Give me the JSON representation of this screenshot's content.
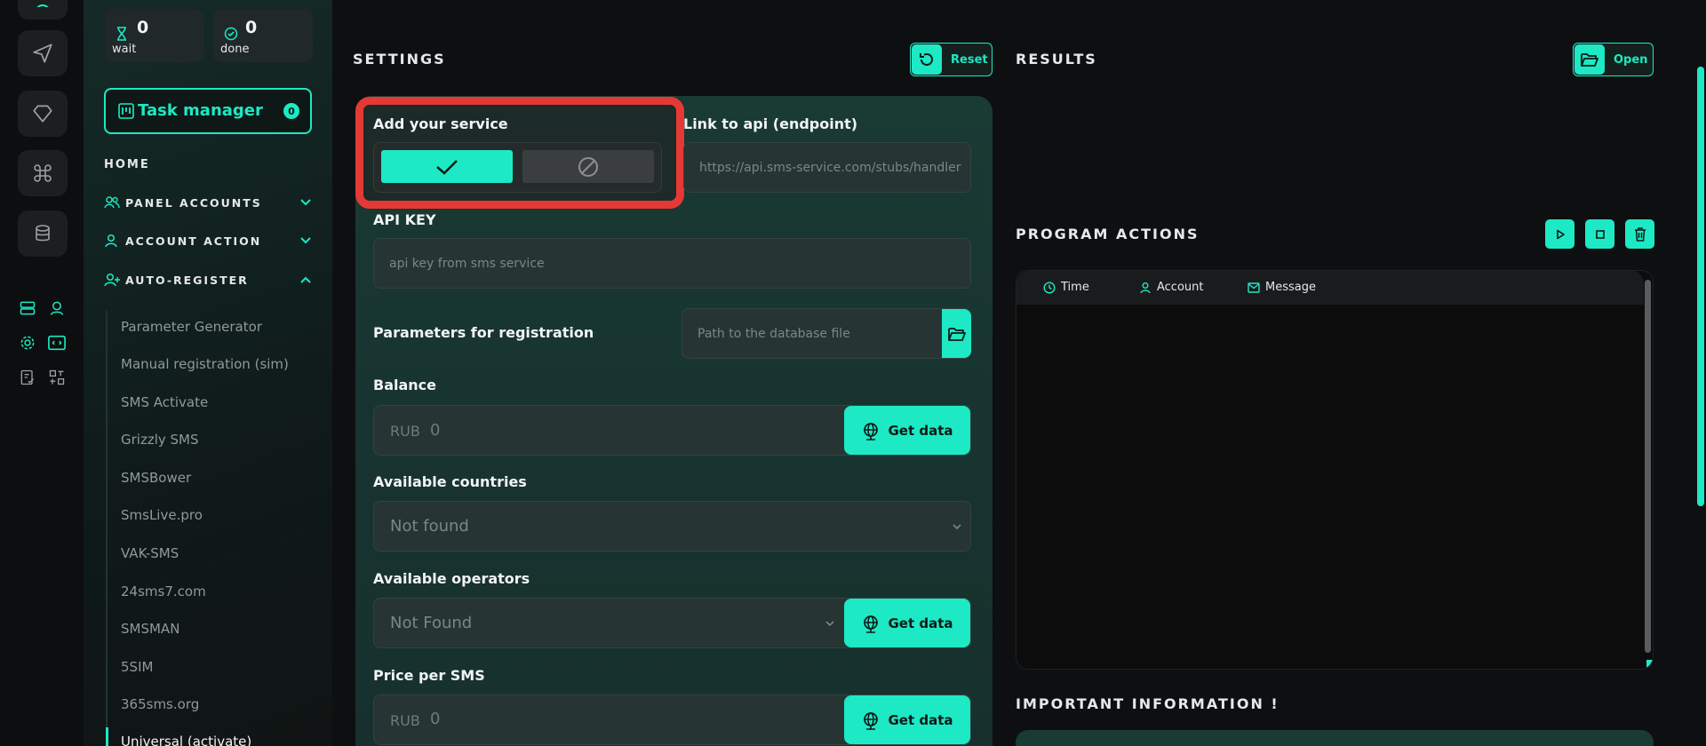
{
  "stats": {
    "wait": {
      "value": "0",
      "label": "wait"
    },
    "done": {
      "value": "0",
      "label": "done"
    }
  },
  "task_manager": {
    "label": "Task manager",
    "count": "0"
  },
  "nav": {
    "home": "HOME",
    "sections": [
      {
        "label": "PANEL ACCOUNTS",
        "icon": "users-icon",
        "expanded": false
      },
      {
        "label": "ACCOUNT ACTION",
        "icon": "user-icon",
        "expanded": false
      },
      {
        "label": "AUTO-REGISTER",
        "icon": "user-plus-icon",
        "expanded": true
      }
    ],
    "auto_register_items": [
      "Parameter Generator",
      "Manual registration (sim)",
      "SMS Activate",
      "Grizzly SMS",
      "SMSBower",
      "SmsLive.pro",
      "VAK-SMS",
      "24sms7.com",
      "SMSMAN",
      "5SIM",
      "365sms.org",
      "Universal (activate)"
    ],
    "active_item": "Universal (activate)"
  },
  "settings": {
    "title": "SETTINGS",
    "reset_label": "Reset",
    "add_service_label": "Add your service",
    "add_service_enabled": true,
    "link_label": "Link to api (endpoint)",
    "link_placeholder": "https://api.sms-service.com/stubs/handler",
    "api_key_label": "API KEY",
    "api_key_placeholder": "api key from sms service",
    "params_label": "Parameters for registration",
    "params_placeholder": "Path to the database file",
    "balance_label": "Balance",
    "balance_currency": "RUB",
    "balance_value": "0",
    "get_data_label": "Get data",
    "countries_label": "Available countries",
    "countries_value": "Not found",
    "operators_label": "Available operators",
    "operators_value": "Not Found",
    "price_label": "Price per SMS",
    "price_currency": "RUB",
    "price_value": "0"
  },
  "results": {
    "title": "RESULTS",
    "open_label": "Open"
  },
  "program_actions": {
    "title": "PROGRAM ACTIONS",
    "columns": [
      "Time",
      "Account",
      "Message"
    ]
  },
  "important": {
    "title": "IMPORTANT INFORMATION !"
  },
  "colors": {
    "accent": "#1de9c4",
    "highlight": "#e53935",
    "panel": "#1a3a34"
  }
}
